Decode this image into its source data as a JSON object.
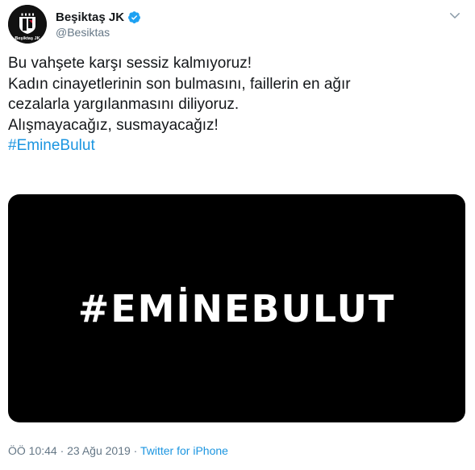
{
  "author": {
    "display_name": "Beşiktaş JK",
    "handle": "@Besiktas",
    "avatar_text": "Beşiktaş JK",
    "verified": true
  },
  "tweet": {
    "lines": [
      "Bu vahşete karşı sessiz kalmıyoruz!",
      "Kadın cinayetlerinin son bulmasını, faillerin en ağır",
      "cezalarla yargılanmasını diliyoruz.",
      "Alışmayacağız, susmayacağız!"
    ],
    "hashtag": "#EmineBulut"
  },
  "media": {
    "text": "#EMİNEBULUT",
    "background": "#000000"
  },
  "meta": {
    "timestamp": "ÖÖ 10:44 · 23 Ağu 2019",
    "separator": " · ",
    "source": "Twitter for iPhone"
  },
  "colors": {
    "link": "#1b95e0",
    "secondary_text": "#657786",
    "verified": "#1da1f2"
  },
  "icons": {
    "verified": "verified-badge-icon",
    "caret": "chevron-down-icon"
  }
}
